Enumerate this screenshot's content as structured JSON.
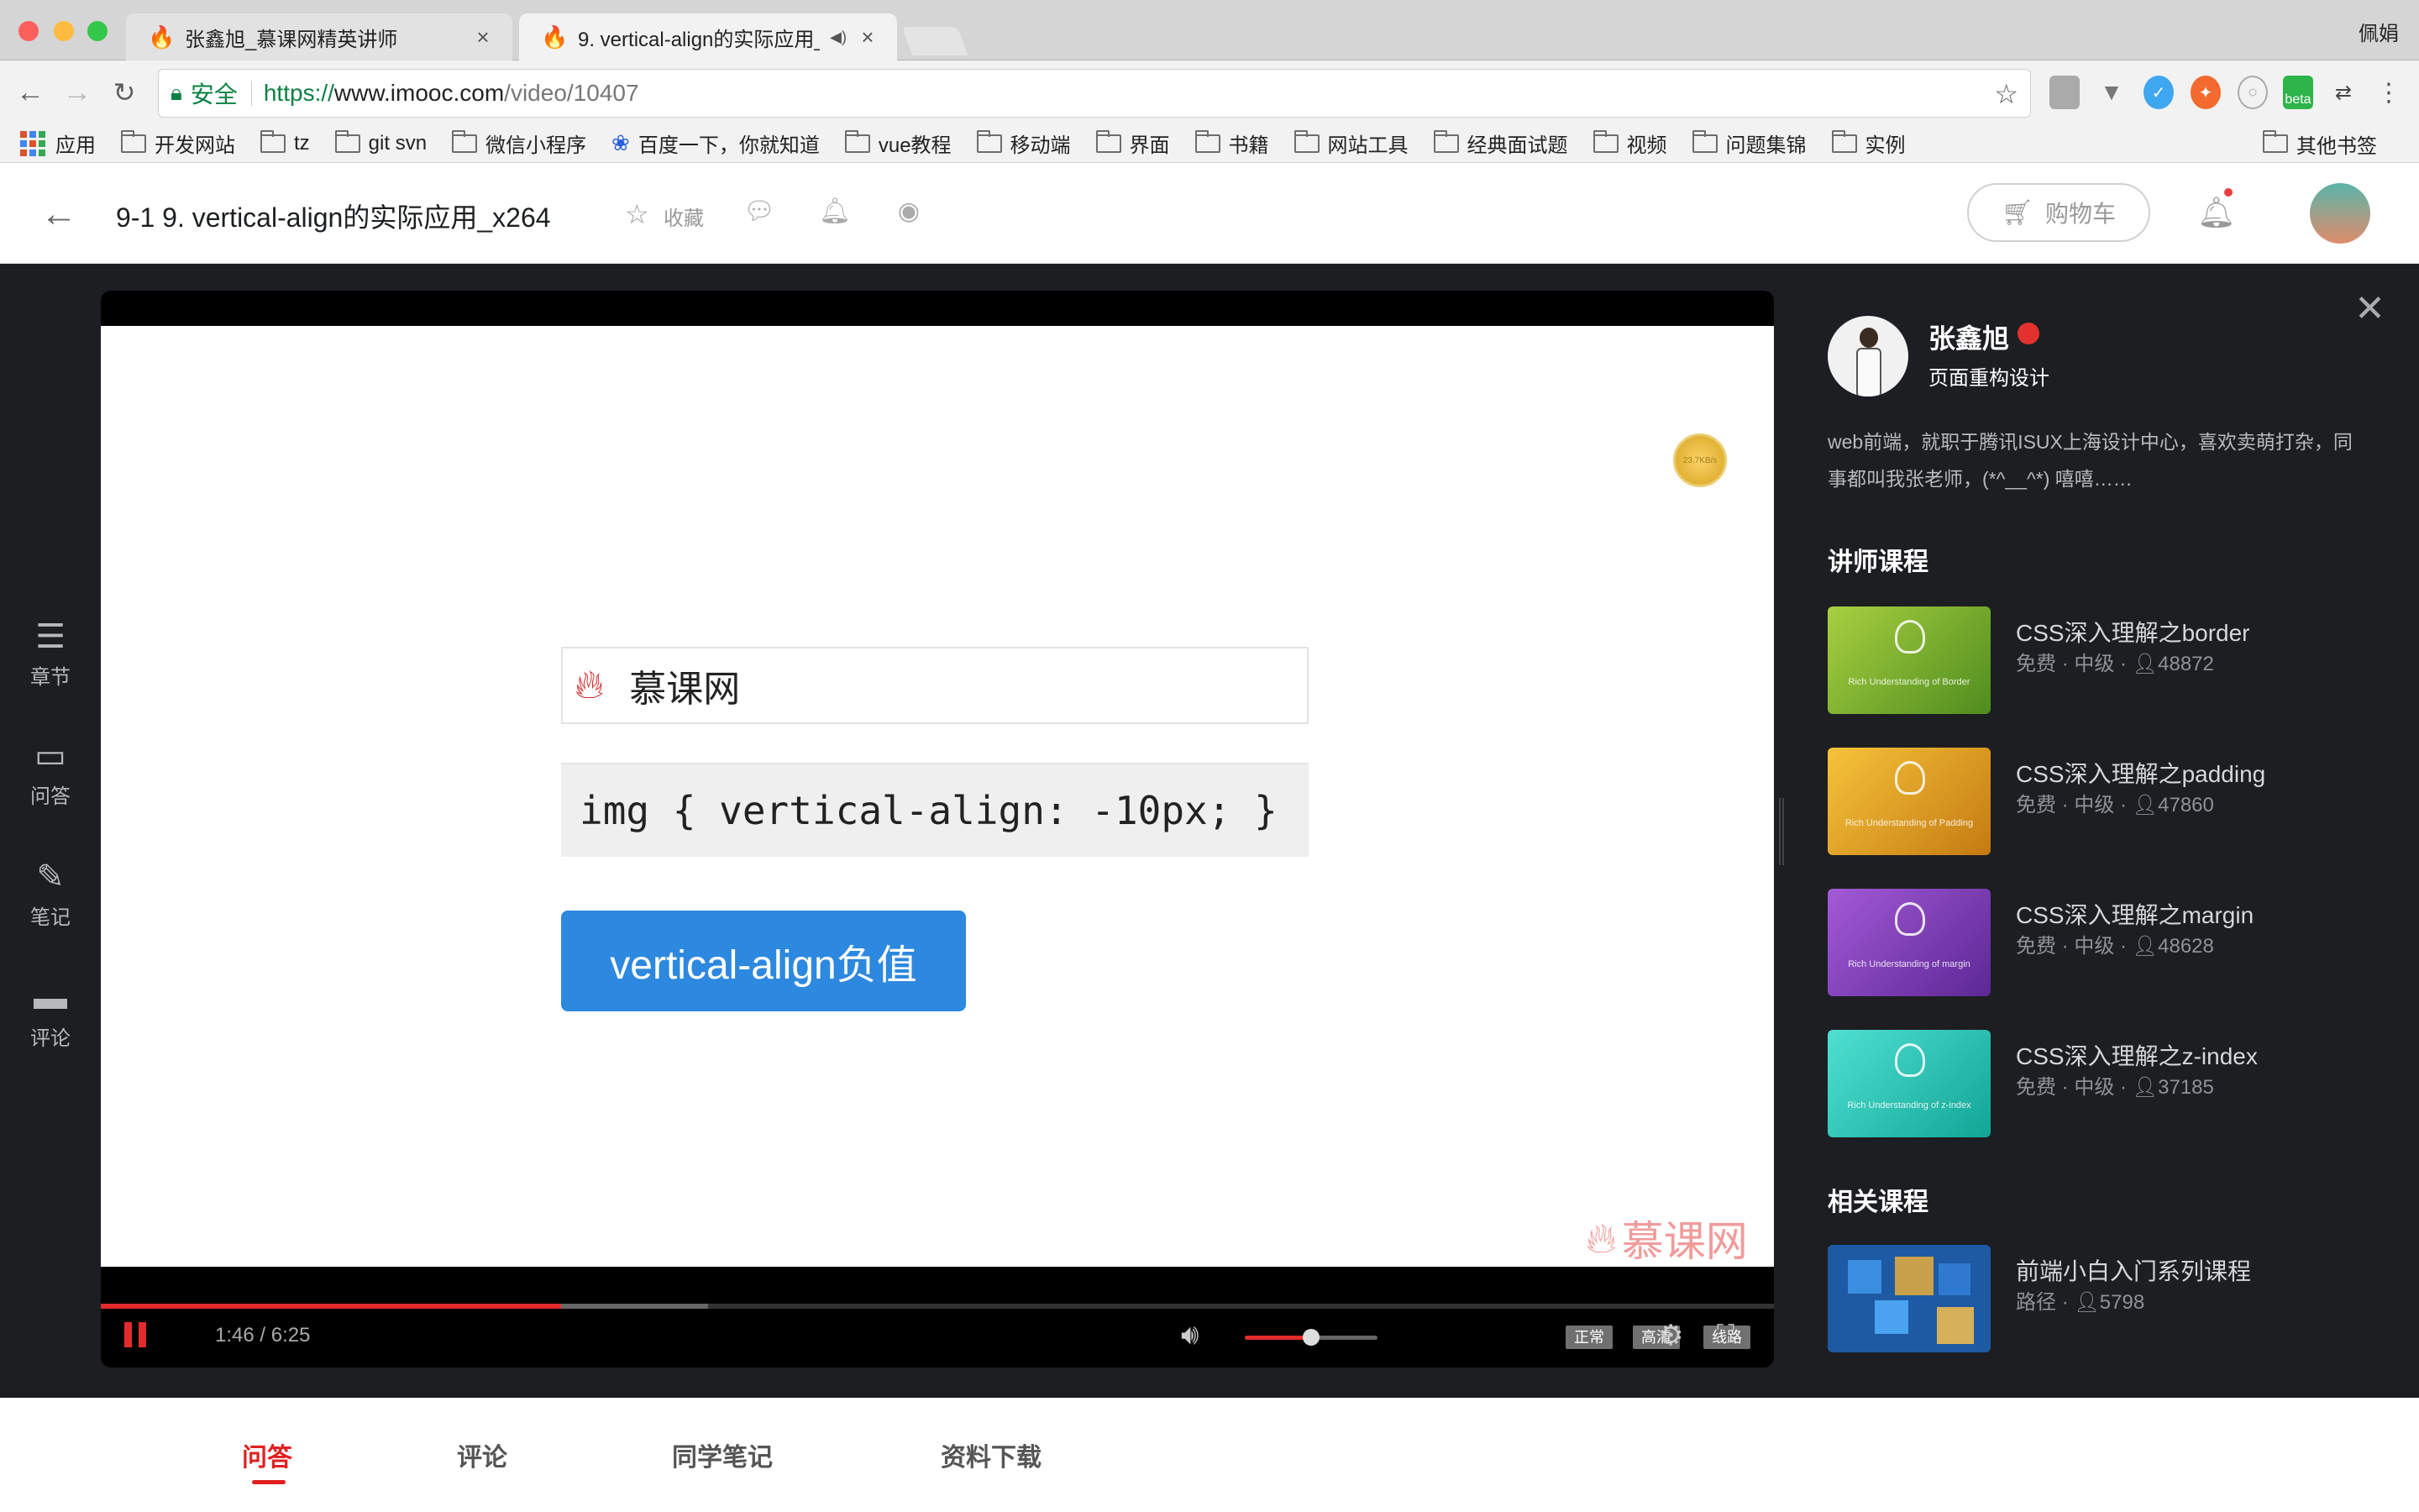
{
  "browser": {
    "tabs": [
      {
        "title": "张鑫旭_慕课网精英讲师",
        "close": "×"
      },
      {
        "title": "9. vertical-align的实际应用_",
        "audio": "◀)",
        "close": "×"
      }
    ],
    "profile_name": "佩娟",
    "secure_label": "安全",
    "url": {
      "scheme": "https://",
      "host": "www.imooc.com",
      "path": "/video/10407"
    },
    "bookmarks": [
      "应用",
      "开发网站",
      "tz",
      "git svn",
      "微信小程序",
      "百度一下，你就知道",
      "vue教程",
      "移动端",
      "界面",
      "书籍",
      "网站工具",
      "经典面试题",
      "视频",
      "问题集锦",
      "实例"
    ],
    "other_bookmarks": "其他书签",
    "extension_beta_label": "beta"
  },
  "header": {
    "title": "9-1 9. vertical-align的实际应用_x264",
    "favorite_label": "收藏",
    "cart_label": "购物车"
  },
  "left_nav": [
    {
      "label": "章节",
      "icon": "chapters-icon"
    },
    {
      "label": "问答",
      "icon": "qa-icon"
    },
    {
      "label": "笔记",
      "icon": "notes-icon"
    },
    {
      "label": "评论",
      "icon": "comments-icon"
    }
  ],
  "player": {
    "slide": {
      "logo_text": "慕课网",
      "code": "img { vertical-align: -10px; }",
      "button_text": "vertical-align负值",
      "watermark": "慕课网",
      "coin_text": "23.7KB/s"
    },
    "current_time": "1:46",
    "duration": "6:25",
    "time_display": "1:46 / 6:25",
    "played_fraction": 0.275,
    "buffered_fraction": 0.363,
    "volume_fraction": 0.5,
    "quality_options": [
      "正常",
      "高清",
      "线路"
    ]
  },
  "teacher": {
    "name": "张鑫旭",
    "title": "页面重构设计",
    "bio": "web前端，就职于腾讯ISUX上海设计中心，喜欢卖萌打杂，同事都叫我张老师，(*^__^*) 嘻嘻……"
  },
  "teacher_courses_title": "讲师课程",
  "teacher_courses": [
    {
      "title": "CSS深入理解之border",
      "price": "免费",
      "level": "中级",
      "students": "48872",
      "thumb_text": "Rich Understanding of Border",
      "color_a": "#9bc43a",
      "color_b": "#4f8c1e"
    },
    {
      "title": "CSS深入理解之padding",
      "price": "免费",
      "level": "中级",
      "students": "47860",
      "thumb_text": "Rich Understanding of Padding",
      "color_a": "#f0b52a",
      "color_b": "#c47a12"
    },
    {
      "title": "CSS深入理解之margin",
      "price": "免费",
      "level": "中级",
      "students": "48628",
      "thumb_text": "Rich Understanding of margin",
      "color_a": "#9a4fcf",
      "color_b": "#5c2796"
    },
    {
      "title": "CSS深入理解之z-index",
      "price": "免费",
      "level": "中级",
      "students": "37185",
      "thumb_text": "Rich Understanding of z-index",
      "color_a": "#3fd6c6",
      "color_b": "#12a596"
    }
  ],
  "related_courses_title": "相关课程",
  "related_courses": [
    {
      "title": "前端小白入门系列课程",
      "type": "路径",
      "students": "5798"
    }
  ],
  "bottom_tabs": [
    "问答",
    "评论",
    "同学笔记",
    "资料下载"
  ],
  "colors": {
    "accent": "#e02020",
    "player_progress": "#e32b2b",
    "slide_button": "#2d88df",
    "panel_bg": "#1c1e22"
  }
}
